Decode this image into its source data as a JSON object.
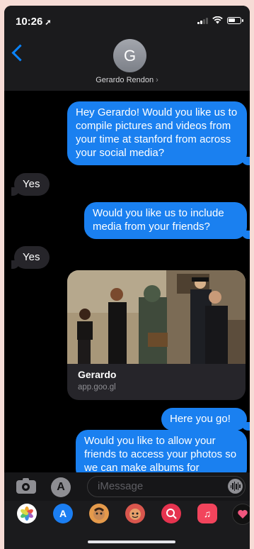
{
  "status": {
    "time": "10:26",
    "location_arrow": "➚"
  },
  "header": {
    "avatar_initial": "G",
    "contact_name": "Gerardo Rendon",
    "contact_chevron": "›"
  },
  "messages": [
    {
      "from": "me",
      "text": "Hey Gerardo! Would you like us to compile pictures and videos from your time at stanford from across your social media?"
    },
    {
      "from": "them",
      "text": "Yes"
    },
    {
      "from": "me",
      "text": "Would you like us to include media from your friends?"
    },
    {
      "from": "them",
      "text": "Yes"
    },
    {
      "from": "me",
      "type": "link",
      "title": "Gerardo",
      "url": "app.goo.gl"
    },
    {
      "from": "me",
      "text": "Here you go!"
    },
    {
      "from": "me",
      "text": "Would you like to allow your friends to access your photos so we can make albums for"
    }
  ],
  "input": {
    "placeholder": "iMessage"
  },
  "colors": {
    "sent_bubble": "#1a80f0",
    "received_bubble": "#26252a",
    "accent": "#0a84ff",
    "background": "#000000"
  },
  "app_drawer": [
    "photos-icon",
    "appstore-icon",
    "memoji-icon",
    "animoji-icon",
    "web-search-icon",
    "music-icon",
    "digital-touch-icon"
  ]
}
